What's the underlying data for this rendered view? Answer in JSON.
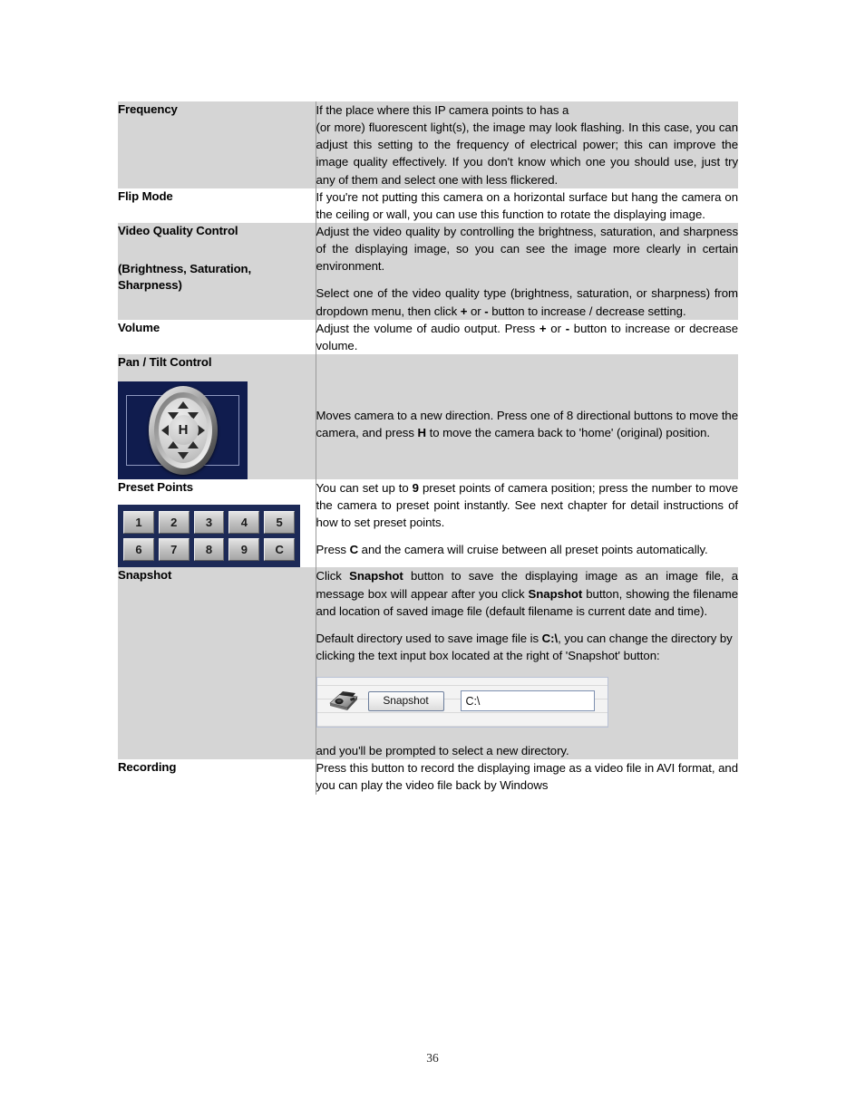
{
  "document": {
    "page_number": "36",
    "colors": {
      "shaded_row": "#d5d5d5",
      "widget_navy": "#1d2a57",
      "joystick_navy": "#101c4e",
      "divider": "#9a9a9a"
    }
  },
  "table": {
    "rows": [
      {
        "id": "frequency",
        "shaded": true,
        "label": "Frequency",
        "paragraphs": [
          "If the place where this IP camera points to has a",
          "(or more) fluorescent light(s), the image may look flashing. In this case, you can adjust this setting to the frequency of electrical power; this can improve the image quality effectively.   If you don't know which one you should use, just try any of them and select one with less flickered."
        ]
      },
      {
        "id": "flip-mode",
        "shaded": false,
        "label": "Flip Mode",
        "paragraphs": [
          "If you're not putting this camera on a horizontal surface but hang the camera on the ceiling or wall, you can use this function to rotate the displaying image."
        ]
      },
      {
        "id": "video-quality-control",
        "shaded": true,
        "label": "Video Quality Control",
        "label_line2": "(Brightness, Saturation, Sharpness)",
        "paragraphs": [
          "Adjust the video quality by controlling the brightness, saturation, and sharpness of the displaying image, so you can see the image more clearly in certain environment.",
          "Select one of the video quality type (brightness, saturation, or sharpness) from dropdown menu, then click + or - button to increase / decrease setting."
        ]
      },
      {
        "id": "volume",
        "shaded": false,
        "label": "Volume",
        "paragraphs": [
          "Adjust the volume of audio output. Press + or - button to increase or decrease volume."
        ]
      },
      {
        "id": "pan-tilt-control",
        "shaded": true,
        "label": "Pan / Tilt Control",
        "paragraphs": [
          "Moves camera to a new direction. Press one of 8 directional buttons to move the camera, and press H to move the camera back to 'home' (original) position."
        ]
      },
      {
        "id": "preset-points",
        "shaded": false,
        "label": "Preset Points",
        "paragraphs": [
          "You can set up to 9 preset points of camera position; press the number to move the camera to preset point instantly. See next chapter for detail instructions of how to set preset points.",
          "Press C and the camera will cruise between all preset points automatically."
        ]
      },
      {
        "id": "snapshot",
        "shaded": true,
        "label": "Snapshot",
        "paragraphs": [
          "Click Snapshot button to save the displaying image as an image file, a message box will appear after you click Snapshot button, showing the filename and location of saved image file (default filename is current date and time).",
          "Default directory used to save image file is C:\\, you can change the directory by clicking the text input box located at the right of 'Snapshot' button:",
          "and you'll be prompted to select a new directory."
        ]
      },
      {
        "id": "recording",
        "shaded": false,
        "label": "Recording",
        "paragraphs": [
          "Press this button to record the displaying image as a video file in AVI format, and you can play the video file back by Windows"
        ]
      }
    ]
  },
  "widgets": {
    "joystick": {
      "home_label": "H",
      "directions": [
        "up",
        "up-right",
        "right",
        "down-right",
        "down",
        "down-left",
        "left",
        "up-left"
      ]
    },
    "preset_points": {
      "row1": [
        "1",
        "2",
        "3",
        "4",
        "5"
      ],
      "row2": [
        "6",
        "7",
        "8",
        "9",
        "C"
      ]
    },
    "snapshot_panel": {
      "button_label": "Snapshot",
      "path_value": "C:\\",
      "icon": "camera-icon"
    }
  }
}
